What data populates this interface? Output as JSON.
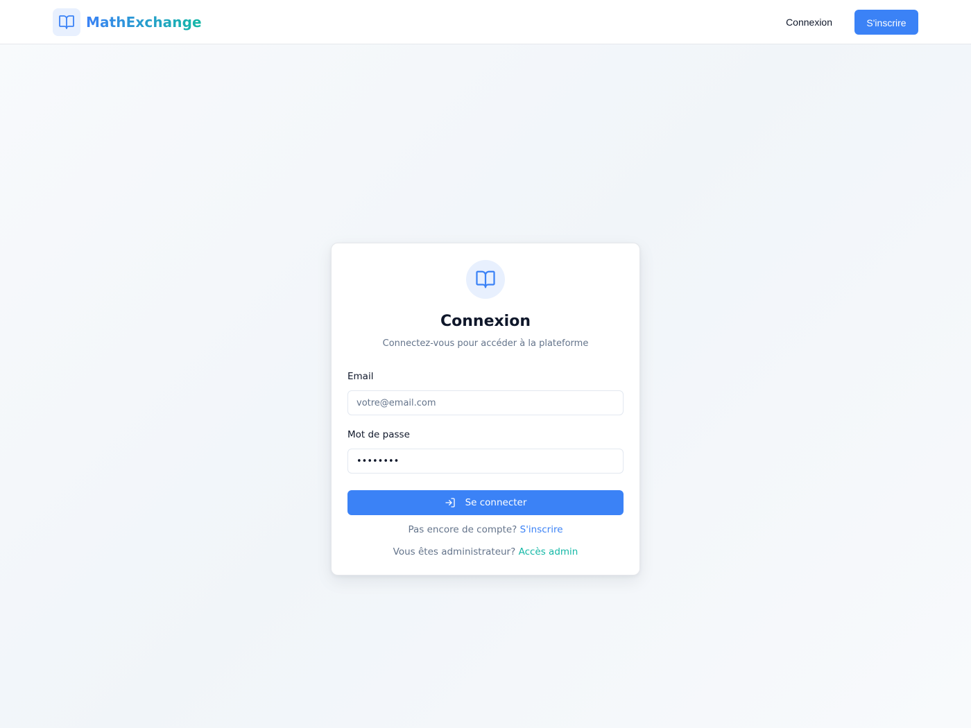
{
  "header": {
    "brand_name": "MathExchange",
    "nav_login_label": "Connexion",
    "nav_signup_label": "S'inscrire"
  },
  "login_card": {
    "title": "Connexion",
    "subtitle": "Connectez-vous pour accéder à la plateforme",
    "email_label": "Email",
    "email_placeholder": "votre@email.com",
    "email_value": "",
    "password_label": "Mot de passe",
    "password_value": "••••••••",
    "submit_label": "Se connecter",
    "signup_prompt": "Pas encore de compte?",
    "signup_link": "S'inscrire",
    "admin_prompt": "Vous êtes administrateur?",
    "admin_link": "Accès admin"
  },
  "icons": {
    "brand": "book-open-icon",
    "card": "book-open-icon",
    "submit": "log-in-icon"
  },
  "colors": {
    "primary": "#3b82f6",
    "accent": "#14b8a6",
    "icon_bg": "#e8f0fe",
    "muted_text": "#64748b",
    "text": "#0f172a"
  }
}
